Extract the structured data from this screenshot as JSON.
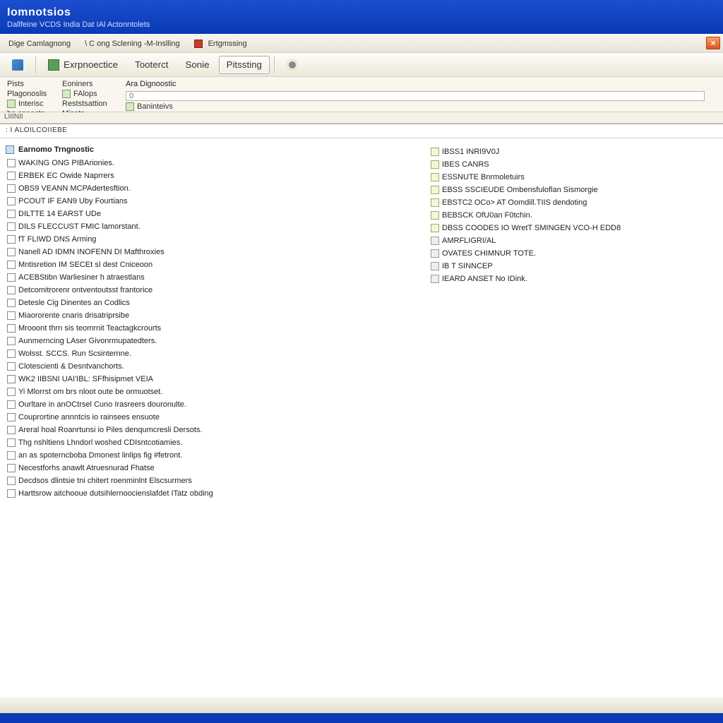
{
  "titlebar": {
    "title": "Iomnotsios",
    "subtitle": "Dallfeine VCDS India Dat IAl Actonntolets"
  },
  "menubar": {
    "items": [
      "Dige Camlagnong",
      "\\ C ong Sclening -M-Inslling",
      "Ertgmssing"
    ],
    "close": "×"
  },
  "toolbar": {
    "buttons": [
      "",
      "Exrpnoectice",
      "Tooterct",
      "Sonie",
      "Pitssting",
      ""
    ]
  },
  "subnav": {
    "col1": [
      "Pists",
      "Plagonoslis",
      "Interisc",
      "bo copects"
    ],
    "col2": [
      "Eoniners",
      "FAlops",
      "Reststsattion",
      "Misets"
    ],
    "col3_header": "Ara Dignoostic",
    "col3_field": "0",
    "col3_link": "Baninteivs"
  },
  "statusline": "LIIINII",
  "crumb": ": I ALOILCOIIEBE",
  "left_section_title": "Earnomo Trngnostic",
  "left_items": [
    "WAKING ONG PIBArionies.",
    "ERBEK EC Owide Naprrers",
    "OBS9 VEANN  MCPAdertesftion.",
    "PCOUT IF EAN9 Uby Fourtians",
    "DILTTE 14 EARST UDe",
    "DILS  FLECCUST FMIC lamorstant.",
    "fT FLIWD DNS  Arming",
    "Nanell AD IDMN INOFENN DI Mafthroxies",
    "Mntisretion  IM SECEt sI dest Cniceoon",
    "ACEBStibn Warliesiner h atraestlans",
    "Detcomitrorenr ontventoutsst frantorice",
    "Detesle Cig Dinentes an Codlics",
    "Miaororente cnaris drisatriprsibe",
    "Mrooont thrn sis teomrnit Teactagkcrourts",
    "Aunmerncing LAser Givonrmupatedters.",
    "Wolsst. SCCS. Run Scsinternne.",
    "Clotescienti & Desntvanchorts.",
    "WK2 IIBSNI  UAI'IBL: SFfhisipmet VEIA",
    "Yi Mlorrst om brs nloot oute be ormuotset.",
    "Ourltare in anOCtrsel Cuno Irasreers douronulte.",
    "Couprortine annntcis io rainsees ensuote",
    "Areral hoal Roanrtunsi io Piles denqumcresli Dersots.",
    "Thg nshltiens Lhndorl woshed CDIsntcotiamies.",
    "an as spoterncboba Dmonest linlips fig #fetront.",
    "Necestforhs anawlt Atruesnurad Fhatse",
    "Decdsos dlintsie tni chitert roenminlnt Elscsurmers",
    "Harttsrow aitchooue dutsihlernoocienslafdet ITatz obding"
  ],
  "right_items": [
    "IBSS1 INRI9V0J",
    "IBES CANRS",
    "ESSNUTE Bnrmoletuirs",
    "EBSS  SSCIEUDE Ombensfuloflan Sismorgie",
    "EBSTC2 OCo> AT Oomdill.TIIS dendoting",
    "BEBSCK OfU0an F0tchin.",
    "  DBSS  COODES IO WretT SMINGEN VCO-H EDD8",
    "AMRFLIGRI/AL",
    "OVATES CHIMNUR TOTE.",
    "IB T SINNCEP",
    "IEARD ANSET No IDink."
  ]
}
